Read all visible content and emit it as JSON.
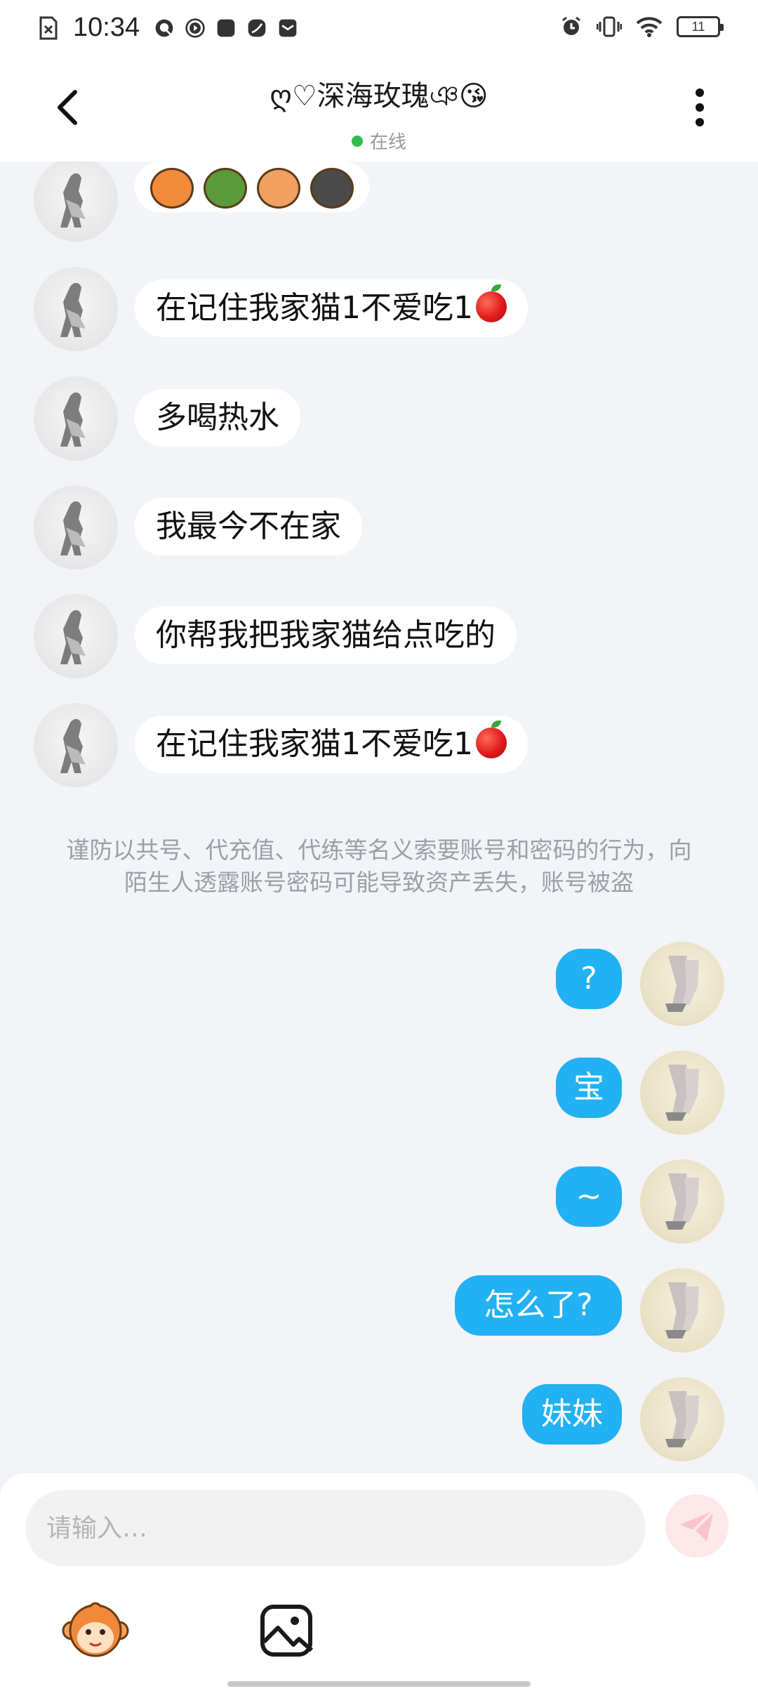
{
  "status_bar": {
    "time": "10:34",
    "battery": "11",
    "left_icons": [
      "sim-off-icon",
      "q-icon",
      "play-icon",
      "app-square-icon",
      "leaf-icon",
      "mail-icon"
    ],
    "right_icons": [
      "alarm-icon",
      "vibrate-icon",
      "wifi-icon",
      "battery-icon"
    ]
  },
  "header": {
    "title": "ღ♡深海玫瑰ঞ😘",
    "status": "在线",
    "status_color": "#2ebd4e",
    "back_icon": "chevron-left-icon",
    "more_icon": "more-vertical-icon"
  },
  "messages_in": [
    {
      "text": "",
      "emoji_row": [
        "monkey-surprised-emoji",
        "monkey-helmet-emoji",
        "monkey-cry-emoji",
        "skull-emoji"
      ]
    },
    {
      "text": "在记住我家猫1不爱吃1",
      "apple": true
    },
    {
      "text": "多喝热水"
    },
    {
      "text": "我最今不在家"
    },
    {
      "text": "你帮我把我家猫给点吃的"
    },
    {
      "text": "在记住我家猫1不爱吃1",
      "apple": true
    }
  ],
  "notice": "谨防以共号、代充值、代练等名义索要账号和密码的行为，向陌生人透露账号密码可能导致资产丢失，账号被盗",
  "messages_out": [
    {
      "text": "?"
    },
    {
      "text": "宝"
    },
    {
      "text": "~"
    },
    {
      "text": "怎么了?"
    },
    {
      "text": "妹妹"
    }
  ],
  "composer": {
    "placeholder": "请输入…",
    "send_icon": "paper-plane-icon",
    "tools": [
      "monkey-emoji-icon",
      "image-icon"
    ]
  },
  "colors": {
    "bubble_out": "#22b1f2",
    "bubble_in": "#ffffff",
    "background": "#f2f4f7"
  }
}
